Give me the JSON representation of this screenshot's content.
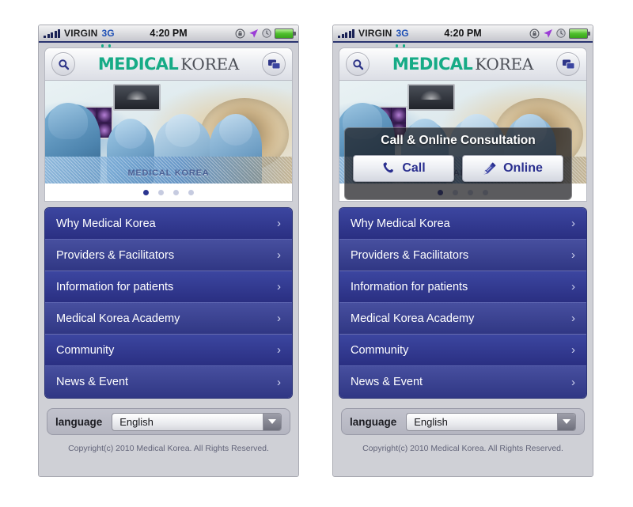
{
  "status_bar": {
    "carrier": "VIRGIN",
    "network": "3G",
    "time": "4:20 PM",
    "icons": [
      "rotation-lock-icon",
      "location-arrow-icon",
      "alarm-clock-icon",
      "battery-icon"
    ]
  },
  "header": {
    "search_icon": "search-icon",
    "chat_icon": "chat-bubbles-icon",
    "logo_primary": "MEDICAL",
    "logo_secondary": "KOREA",
    "logo_primary_color": "#16ab86",
    "logo_secondary_color": "#4c4f57"
  },
  "hero": {
    "watermark": "MEDICAL KOREA",
    "alt": "operating room with surgeons and CT scanner",
    "dots_total": 4,
    "dot_active_index": 0
  },
  "menu": {
    "items": [
      {
        "label": "Why Medical Korea",
        "chevron": "›"
      },
      {
        "label": "Providers & Facilitators",
        "chevron": "›"
      },
      {
        "label": "Information for patients",
        "chevron": "›"
      },
      {
        "label": "Medical Korea Academy",
        "chevron": "›"
      },
      {
        "label": "Community",
        "chevron": "›"
      },
      {
        "label": "News & Event",
        "chevron": "›"
      }
    ],
    "accent_color": "#2f3688"
  },
  "language": {
    "label": "language",
    "selected": "English",
    "options": [
      "English"
    ]
  },
  "footer": {
    "copyright": "Copyright(c) 2010 Medical Korea. All Rights Reserved."
  },
  "modal": {
    "title": "Call &  Online Consultation",
    "call_label": "Call",
    "online_label": "Online",
    "call_icon": "phone-handset-icon",
    "online_icon": "pencil-icon",
    "button_text_color": "#2a2f8f"
  }
}
